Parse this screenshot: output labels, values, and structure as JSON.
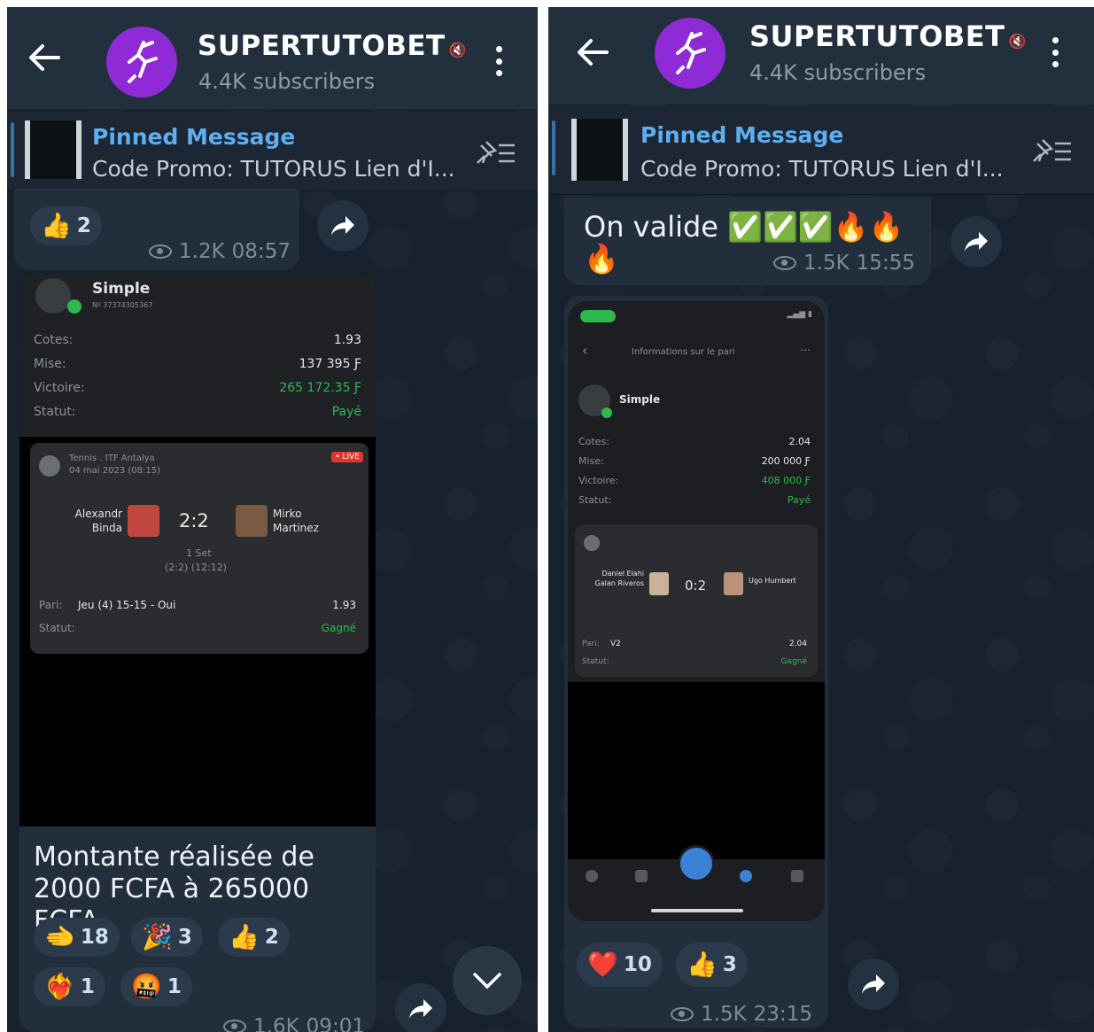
{
  "channel": {
    "name": "SUPERTUTOBET",
    "subscribers": "4.4K subscribers"
  },
  "pinned": {
    "title": "Pinned Message",
    "text": "Code Promo: TUTORUS  Lien d'I..."
  },
  "left": {
    "top_reaction": {
      "emoji": "👍",
      "count": "2"
    },
    "top_meta": {
      "views": "1.2K",
      "time": "08:57"
    },
    "bet": {
      "type": "Simple",
      "ticket": "Nº 37374305367",
      "rows": [
        {
          "label": "Cotes:",
          "value": "1.93"
        },
        {
          "label": "Mise:",
          "value": "137 395 Ƒ"
        },
        {
          "label": "Victoire:",
          "value": "265 172.35 Ƒ"
        },
        {
          "label": "Statut:",
          "value": "Payé"
        }
      ],
      "match": {
        "league": "Tennis . ITF Antalya",
        "date": "04 mai 2023 (08:15)",
        "live": "• LIVE",
        "player1": "Alexandr Binda",
        "player2": "Mirko Martinez",
        "score": "2:2",
        "set": "1 Set",
        "set_detail": "(2:2) (12:12)",
        "pari_label": "Pari:",
        "pari": "Jeu (4) 15-15 - Oui",
        "pari_odds": "1.93",
        "statut_label": "Statut:",
        "statut": "Gagné"
      }
    },
    "message": "Montante réalisée de 2000 FCFA à 265000 FCFA",
    "reactions": [
      {
        "emoji": "🫲",
        "count": "18"
      },
      {
        "emoji": "🎉",
        "count": "3"
      },
      {
        "emoji": "👍",
        "count": "2"
      },
      {
        "emoji": "❤️‍🔥",
        "count": "1"
      },
      {
        "emoji": "🤬",
        "count": "1"
      }
    ],
    "bottom_meta": {
      "views": "1.6K",
      "time": "09:01"
    }
  },
  "right": {
    "top_message": "On valide ✅✅✅🔥🔥🔥",
    "top_meta": {
      "views": "1.5K",
      "time": "15:55"
    },
    "phone": {
      "screen_title": "Informations sur le pari",
      "bet_type": "Simple",
      "rows": [
        {
          "label": "Cotes:",
          "value": "2.04"
        },
        {
          "label": "Mise:",
          "value": "200 000 Ƒ"
        },
        {
          "label": "Victoire:",
          "value": "408 000 Ƒ"
        },
        {
          "label": "Statut:",
          "value": "Payé"
        }
      ],
      "match": {
        "player1": "Daniel Elahi Galan Riveros",
        "player2": "Ugo Humbert",
        "score": "0:2",
        "pari_label": "Pari:",
        "pari": "V2",
        "pari_odds": "2.04",
        "statut_label": "Statut:",
        "statut": "Gagné"
      }
    },
    "reactions": [
      {
        "emoji": "❤️",
        "count": "10"
      },
      {
        "emoji": "👍",
        "count": "3"
      }
    ],
    "bottom_meta": {
      "views": "1.5K",
      "time": "23:15"
    }
  },
  "colors": {
    "background": "#17222e",
    "header": "#222f3d",
    "accent": "#5eaef0",
    "avatar": "#8e2bd6",
    "win_green": "#2fb84f"
  },
  "icons": [
    "back-arrow-icon",
    "mute-icon",
    "more-vert-icon",
    "pin-list-icon",
    "eye-icon",
    "forward-icon",
    "chevron-down-icon"
  ]
}
